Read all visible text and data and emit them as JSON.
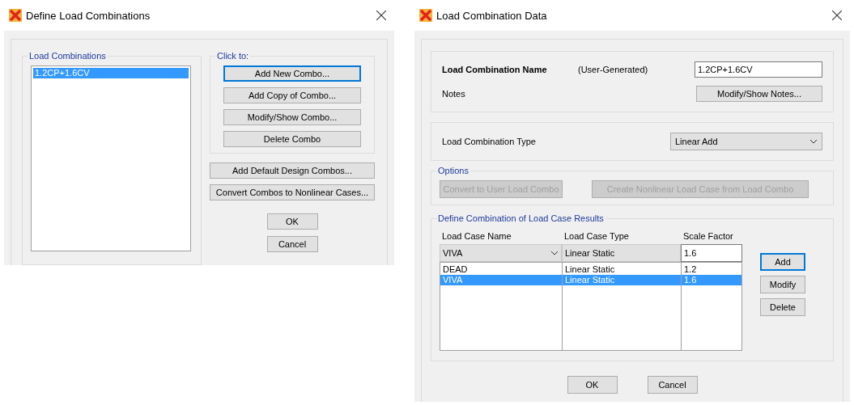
{
  "define_dialog": {
    "title": "Define Load Combinations",
    "combos_group": {
      "label": "Load Combinations",
      "items": [
        {
          "text": "1.2CP+1.6CV",
          "selected": true
        }
      ]
    },
    "click_group": {
      "label": "Click to:",
      "buttons": [
        {
          "label": "Add New Combo...",
          "focused": true
        },
        {
          "label": "Add Copy of Combo...",
          "focused": false
        },
        {
          "label": "Modify/Show Combo...",
          "focused": false
        },
        {
          "label": "Delete Combo",
          "focused": false
        }
      ]
    },
    "extra_buttons": [
      "Add Default Design Combos...",
      "Convert Combos to Nonlinear Cases..."
    ],
    "ok": "OK",
    "cancel": "Cancel"
  },
  "data_dialog": {
    "title": "Load Combination Data",
    "name_row": {
      "label": "Load Combination Name",
      "note": "(User-Generated)",
      "value": "1.2CP+1.6CV"
    },
    "notes": {
      "label": "Notes",
      "button": "Modify/Show Notes..."
    },
    "type_row": {
      "label": "Load Combination Type",
      "value": "Linear Add"
    },
    "options": {
      "label": "Options",
      "buttons": [
        {
          "label": "Convert to User Load Combo",
          "disabled": true
        },
        {
          "label": "Create Nonlinear Load Case from Load Combo",
          "disabled": true
        }
      ]
    },
    "results": {
      "label": "Define Combination of Load Case Results",
      "columns": [
        "Load Case Name",
        "Load Case Type",
        "Scale Factor"
      ],
      "editor": {
        "case": "VIVA",
        "type": "Linear Static",
        "factor": "1.6"
      },
      "rows": [
        {
          "cells": [
            "DEAD",
            "Linear Static",
            "1.2"
          ],
          "selected": false
        },
        {
          "cells": [
            "VIVA",
            "Linear Static",
            "1.6"
          ],
          "selected": true
        }
      ],
      "buttons": [
        {
          "label": "Add",
          "focused": true
        },
        {
          "label": "Modify",
          "focused": false
        },
        {
          "label": "Delete",
          "focused": false
        }
      ]
    },
    "ok": "OK",
    "cancel": "Cancel"
  }
}
